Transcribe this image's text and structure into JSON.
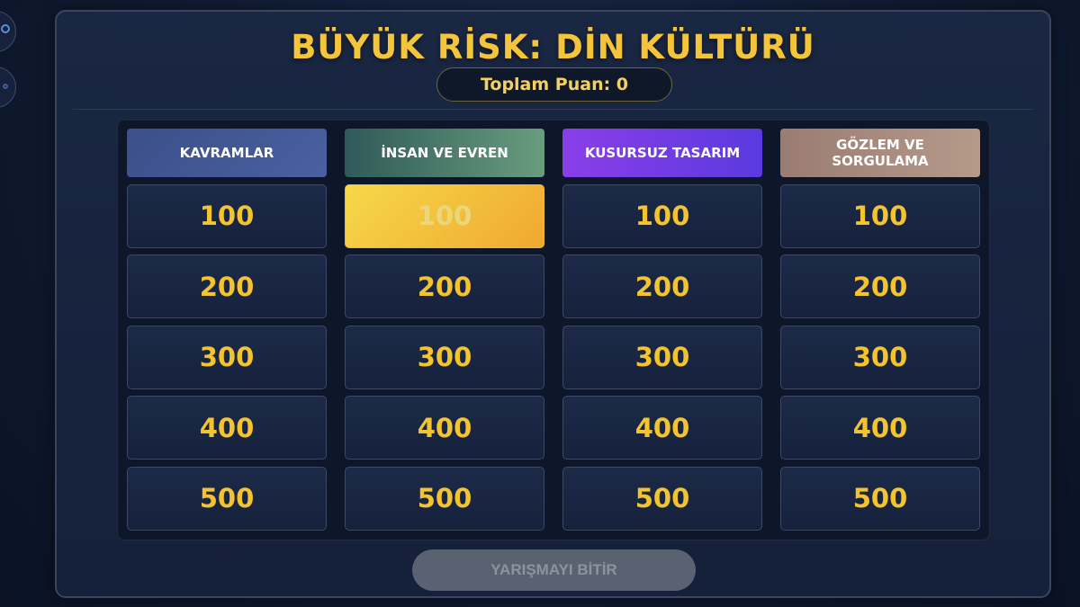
{
  "title": "BÜYÜK RİSK: DİN KÜLTÜRÜ",
  "score": {
    "label": "Toplam Puan: 0"
  },
  "categories": [
    {
      "label": "KAVRAMLAR"
    },
    {
      "label": "İNSAN VE EVREN"
    },
    {
      "label": "KUSURSUZ TASARIM"
    },
    {
      "label": "GÖZLEM VE SORGULAMA"
    }
  ],
  "values": [
    "100",
    "200",
    "300",
    "400",
    "500"
  ],
  "selected_tile": {
    "category": "İNSAN VE EVREN",
    "value": "100"
  },
  "finish_button": {
    "label": "YARIŞMAYI BİTİR"
  },
  "colors": {
    "accent": "#f4c43a",
    "background": "#15203a",
    "tile": "#1c2a48",
    "selected": "#f0b840"
  }
}
